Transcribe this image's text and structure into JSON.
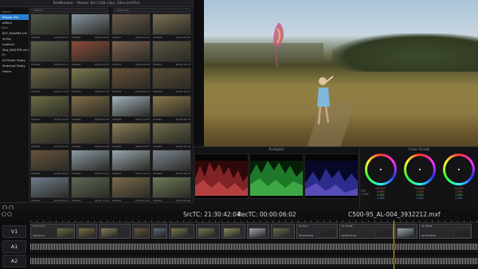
{
  "bin": {
    "title": "BinWindow – Master Bin [33b clips, 28no3m05s]",
    "search_placeholder": "Search",
    "sort_placeholder": "Order By",
    "sidebar": [
      {
        "label": "Library",
        "type": "head"
      },
      {
        "label": "Master Bin",
        "selected": true
      },
      {
        "label": "offline"
      },
      {
        "label": "Sets",
        "type": "head"
      },
      {
        "label": "BLF_SkipNM.xml"
      },
      {
        "label": "dying"
      },
      {
        "label": "myfest1"
      },
      {
        "label": "Skp_MASTER.xml"
      },
      {
        "label": "Mk",
        "type": "head"
      },
      {
        "label": "All Shots Today"
      },
      {
        "label": "Selected Today"
      },
      {
        "label": "trailer"
      }
    ],
    "thumbs": [
      {
        "name": "000025",
        "tc": "00:00:32:01",
        "color": "#4d5848"
      },
      {
        "name": "000026",
        "tc": "00:00:08:22",
        "color": "#8593a0"
      },
      {
        "name": "000027",
        "tc": "00:00:41:12",
        "color": "#6a5a4a"
      },
      {
        "name": "000028",
        "tc": "00:00:05:08",
        "color": "#7b6f55"
      },
      {
        "name": "000029",
        "tc": "00:00:14:17",
        "color": "#5a5e4a"
      },
      {
        "name": "000030",
        "tc": "00:00:22:03",
        "color": "#8a4a3a"
      },
      {
        "name": "000031",
        "tc": "00:00:09:26",
        "color": "#7a6050"
      },
      {
        "name": "000032",
        "tc": "00:00:18:11",
        "color": "#5a5440"
      },
      {
        "name": "000033",
        "tc": "00:00:11:04",
        "color": "#6e6a48"
      },
      {
        "name": "000034",
        "tc": "00:00:27:19",
        "color": "#7c7a50"
      },
      {
        "name": "000035",
        "tc": "00:00:06:15",
        "color": "#6a5038"
      },
      {
        "name": "000036",
        "tc": "00:00:31:02",
        "color": "#5b4d36"
      },
      {
        "name": "000037",
        "tc": "00:00:15:09",
        "color": "#6b6d44"
      },
      {
        "name": "000038",
        "tc": "00:00:07:24",
        "color": "#7f6d48"
      },
      {
        "name": "000039",
        "tc": "00:00:12:05",
        "color": "#a3b2bd"
      },
      {
        "name": "000040",
        "tc": "00:00:20:13",
        "color": "#8a7a4c"
      },
      {
        "name": "000041",
        "tc": "00:00:19:22",
        "color": "#5e5b3e"
      },
      {
        "name": "000042",
        "tc": "00:00:04:18",
        "color": "#6f6445"
      },
      {
        "name": "000043",
        "tc": "00:00:25:07",
        "color": "#8a7e55"
      },
      {
        "name": "000044",
        "tc": "00:00:13:16",
        "color": "#6d6b4a"
      },
      {
        "name": "000045",
        "tc": "00:00:16:02",
        "color": "#66543c"
      },
      {
        "name": "000046",
        "tc": "00:00:23:27",
        "color": "#8a9aa5"
      },
      {
        "name": "000047",
        "tc": "00:00:10:10",
        "color": "#9aa6ae"
      },
      {
        "name": "000048",
        "tc": "00:00:29:14",
        "color": "#7b8590"
      },
      {
        "name": "000049",
        "tc": "00:00:08:03",
        "color": "#6f7e8c"
      },
      {
        "name": "000050",
        "tc": "00:00:17:20",
        "color": "#5e6a55"
      },
      {
        "name": "000051",
        "tc": "00:00:21:09",
        "color": "#7a6a4a"
      },
      {
        "name": "000052",
        "tc": "00:00:06:06",
        "color": "#6d7b55"
      }
    ]
  },
  "analyzer": {
    "title": "Analyzer"
  },
  "color_grade": {
    "title": "Color Grade",
    "sat_label": "SAT",
    "sat_value": "1.000",
    "wheels": [
      {
        "label": "OFFSET",
        "r": "0.000",
        "g": "0.000",
        "b": "0.000"
      },
      {
        "label": "POWER",
        "r": "1.000",
        "g": "1.000",
        "b": "1.000"
      },
      {
        "label": "SLOPE",
        "r": "1.000",
        "g": "1.000",
        "b": "1.000"
      }
    ]
  },
  "timecode": {
    "src": "SrcTC: 21:30:42:04",
    "rec": "RecTC: 00:00:06:02",
    "clip_name": "C500-95_AL-004_3932212.mxf"
  },
  "timeline": {
    "tracks": {
      "v1": "V1",
      "a1": "A1",
      "a2": "A2"
    },
    "clips": [
      {
        "name": "112.12.27",
        "tc": "c00:00:01",
        "color": "#6a6a40",
        "w": 56
      },
      {
        "name": "",
        "tc": "",
        "color": "#7a6e45",
        "w": 26
      },
      {
        "name": "",
        "tc": "",
        "color": "#888058",
        "w": 40
      },
      {
        "name": "",
        "tc": "",
        "color": "#6a5a40",
        "w": 22
      },
      {
        "name": "",
        "tc": "",
        "color": "#5a6a7a",
        "w": 20
      },
      {
        "name": "",
        "tc": "",
        "color": "#7a7a4a",
        "w": 32
      },
      {
        "name": "",
        "tc": "",
        "color": "#6f7a52",
        "w": 30
      },
      {
        "name": "",
        "tc": "",
        "color": "#8a8a5a",
        "w": 30
      },
      {
        "name": "",
        "tc": "",
        "color": "#a0aab0",
        "w": 28
      },
      {
        "name": "",
        "tc": "",
        "color": "#6a6a4a",
        "w": 30
      },
      {
        "name": "21.30.1",
        "tc": "00:00:03:00",
        "color": "#2a2a2d",
        "w": 52
      },
      {
        "name": "21.31.08",
        "tc": "00:00:01:00",
        "color": "#2a2a2d",
        "w": 68
      },
      {
        "name": "",
        "tc": "",
        "color": "#9aa6ae",
        "w": 28
      },
      {
        "name": "21.28.49",
        "tc": "00:00:00:00",
        "color": "#2a2a2d",
        "w": 66
      }
    ]
  }
}
